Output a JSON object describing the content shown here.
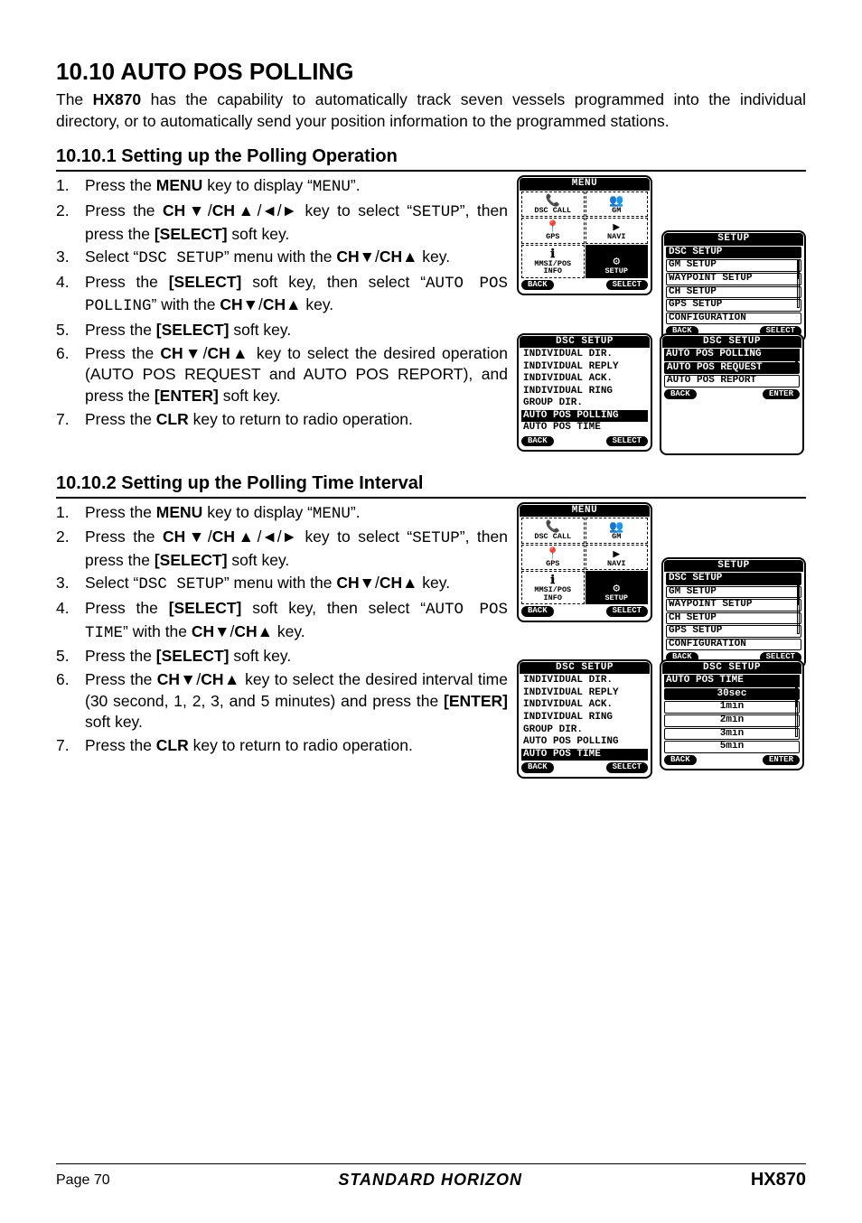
{
  "heading": "10.10  AUTO POS POLLING",
  "intro_parts": [
    "The ",
    "HX870",
    " has the capability to automatically track seven vessels programmed into the individual directory, or to automatically send your position information to the programmed stations."
  ],
  "section1": {
    "heading": "10.10.1  Setting up the Polling Operation",
    "steps": [
      {
        "n": "1.",
        "parts": [
          "Press the ",
          "MENU",
          " key to display “",
          "MENU",
          "”."
        ],
        "mono": [
          3
        ]
      },
      {
        "n": "2.",
        "parts": [
          "Press the ",
          "CH▼",
          "/",
          "CH▲",
          "/◄/► key to select “",
          "SETUP",
          "”, then press the ",
          "[SELECT]",
          " soft key."
        ],
        "mono": [
          5
        ]
      },
      {
        "n": "3.",
        "parts": [
          "Select “",
          "DSC SETUP",
          "” menu with the ",
          "CH▼",
          "/",
          "CH▲",
          " key."
        ],
        "mono": [
          1
        ]
      },
      {
        "n": "4.",
        "parts": [
          "Press the ",
          "[SELECT]",
          " soft key, then select “",
          "AUTO POS POLLING",
          "” with the ",
          "CH▼",
          "/",
          "CH▲",
          " key."
        ],
        "mono": [
          3
        ]
      },
      {
        "n": "5.",
        "parts": [
          "Press the ",
          "[SELECT]",
          " soft key."
        ]
      },
      {
        "n": "6.",
        "parts": [
          "Press the ",
          "CH▼",
          "/",
          "CH▲",
          " key to select the desired operation (AUTO POS REQUEST and AUTO POS REPORT), and press the ",
          "[ENTER]",
          " soft key."
        ]
      },
      {
        "n": "7.",
        "parts": [
          "Press the ",
          "CLR",
          " key to return to radio opera­tion."
        ]
      }
    ]
  },
  "section2": {
    "heading": "10.10.2  Setting up the Polling Time Interval",
    "steps": [
      {
        "n": "1.",
        "parts": [
          "Press the ",
          "MENU",
          " key to display “",
          "MENU",
          "”."
        ],
        "mono": [
          3
        ]
      },
      {
        "n": "2.",
        "parts": [
          "Press the ",
          "CH▼",
          "/",
          "CH▲",
          "/◄/► key to select “",
          "SETUP",
          "”, then press the ",
          "[SELECT]",
          " soft key."
        ],
        "mono": [
          5
        ]
      },
      {
        "n": "3.",
        "parts": [
          "Select “",
          "DSC SETUP",
          "” menu with the ",
          "CH▼",
          "/",
          "CH▲",
          " key."
        ],
        "mono": [
          1
        ]
      },
      {
        "n": "4.",
        "parts": [
          "Press the ",
          "[SELECT]",
          " soft key, then select “",
          "AUTO POS TIME",
          "” with the ",
          "CH▼",
          "/",
          "CH▲",
          " key."
        ],
        "mono": [
          3
        ]
      },
      {
        "n": "5.",
        "parts": [
          "Press the ",
          "[SELECT]",
          " soft key."
        ]
      },
      {
        "n": "6.",
        "parts": [
          "Press the ",
          "CH▼",
          "/",
          "CH▲",
          " key to select the desired interval time (30 second, 1, 2, 3, and 5 minutes) and press the ",
          "[ENTER]",
          " soft key."
        ]
      },
      {
        "n": "7.",
        "parts": [
          "Press the ",
          "CLR",
          " key to return to radio opera­tion."
        ]
      }
    ]
  },
  "screens": {
    "menu": {
      "title": "MENU",
      "cells": [
        "DSC CALL",
        "GM",
        "GPS",
        "NAVI",
        "MMSI/POS\nINFO",
        "SETUP"
      ],
      "selected": 5,
      "back": "BACK",
      "sel": "SELECT"
    },
    "setup": {
      "title": "SETUP",
      "items": [
        "DSC SETUP",
        "GM SETUP",
        "WAYPOINT SETUP",
        "CH SETUP",
        "GPS SETUP",
        "CONFIGURATION"
      ],
      "selected": 0,
      "back": "BACK",
      "sel": "SELECT"
    },
    "dsc_polling": {
      "title": "DSC SETUP",
      "items": [
        "INDIVIDUAL DIR.",
        "INDIVIDUAL REPLY",
        "INDIVIDUAL ACK.",
        "INDIVIDUAL RING",
        "GROUP DIR.",
        "AUTO POS POLLING",
        "AUTO POS TIME"
      ],
      "selected": 5,
      "back": "BACK",
      "sel": "SELECT"
    },
    "dsc_time": {
      "title": "DSC SETUP",
      "items": [
        "INDIVIDUAL DIR.",
        "INDIVIDUAL REPLY",
        "INDIVIDUAL ACK.",
        "INDIVIDUAL RING",
        "GROUP DIR.",
        "AUTO POS POLLING",
        "AUTO POS TIME"
      ],
      "selected": 6,
      "back": "BACK",
      "sel": "SELECT"
    },
    "polling_opts": {
      "title": "DSC SETUP",
      "header": "AUTO POS POLLING",
      "items": [
        "AUTO POS REQUEST",
        "AUTO POS REPORT"
      ],
      "selected": 0,
      "back": "BACK",
      "sel": "ENTER"
    },
    "time_opts": {
      "title": "DSC SETUP",
      "header": "AUTO POS TIME",
      "items": [
        "30sec",
        "1min",
        "2min",
        "3min",
        "5min"
      ],
      "selected": 0,
      "back": "BACK",
      "sel": "ENTER"
    }
  },
  "footer": {
    "page": "Page 70",
    "brand": "STANDARD HORIZON",
    "model": "HX870"
  }
}
